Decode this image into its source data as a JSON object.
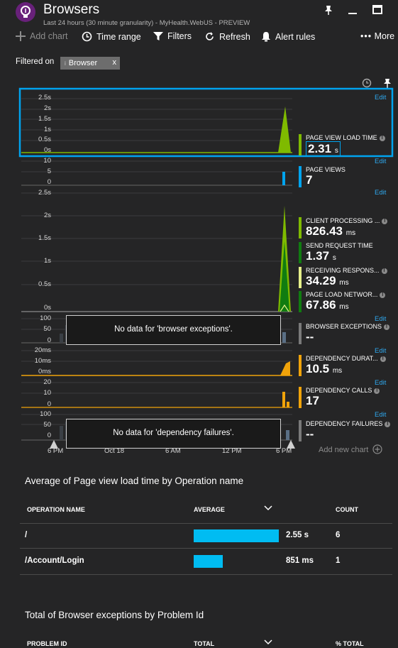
{
  "header": {
    "title": "Browsers",
    "subtitle": "Last 24 hours (30 minute granularity) - MyHealth.WebUS - PREVIEW"
  },
  "toolbar": {
    "add_chart": "Add chart",
    "time_range": "Time range",
    "filters": "Filters",
    "refresh": "Refresh",
    "alert_rules": "Alert rules",
    "more": "More"
  },
  "filter": {
    "label": "Filtered on",
    "chip": "Browser"
  },
  "colors": {
    "accent": "#00a4ef",
    "green": "#7fba00",
    "darkgreen": "#107c10",
    "yellow": "#fcd116",
    "orange": "#f0a30a",
    "blue": "#00bcf2"
  },
  "charts": {
    "edit_label": "Edit",
    "page_view_load": {
      "ylabels": [
        "2.5s",
        "2s",
        "1.5s",
        "1s",
        "0.5s",
        "0s"
      ],
      "kpi_name": "PAGE VIEW LOAD TIME",
      "kpi_value": "2.31",
      "kpi_unit": "s"
    },
    "page_views": {
      "ylabels": [
        "10",
        "5",
        "0"
      ],
      "kpi_name": "PAGE VIEWS",
      "kpi_value": "7",
      "kpi_unit": ""
    },
    "breakdown": {
      "ylabels": [
        "2.5s",
        "2s",
        "1.5s",
        "1s",
        "0.5s",
        "0s"
      ],
      "kpis": [
        {
          "name": "CLIENT PROCESSING ...",
          "value": "826.43",
          "unit": "ms"
        },
        {
          "name": "SEND REQUEST TIME",
          "value": "1.37",
          "unit": "s"
        },
        {
          "name": "RECEIVING RESPONS...",
          "value": "34.29",
          "unit": "ms"
        },
        {
          "name": "PAGE LOAD NETWOR...",
          "value": "67.86",
          "unit": "ms"
        }
      ]
    },
    "browser_exceptions": {
      "ylabels": [
        "100",
        "50",
        "0"
      ],
      "nodata": "No data for 'browser exceptions'.",
      "kpi_name": "BROWSER EXCEPTIONS",
      "kpi_value": "--"
    },
    "dependency_duration": {
      "ylabels": [
        "20ms",
        "10ms",
        "0ms"
      ],
      "kpi_name": "DEPENDENCY DURAT...",
      "kpi_value": "10.5",
      "kpi_unit": "ms"
    },
    "dependency_calls": {
      "ylabels": [
        "20",
        "10",
        "0"
      ],
      "kpi_name": "DEPENDENCY CALLS",
      "kpi_value": "17"
    },
    "dependency_failures": {
      "ylabels": [
        "100",
        "50",
        "0"
      ],
      "nodata": "No data for 'dependency failures'.",
      "kpi_name": "DEPENDENCY FAILURES",
      "kpi_value": "--"
    },
    "xaxis": [
      "6 PM",
      "Oct 18",
      "6 AM",
      "12 PM",
      "6 PM"
    ],
    "add_new_chart": "Add new chart"
  },
  "table1": {
    "title": "Average of Page view load time by Operation name",
    "headers": [
      "OPERATION NAME",
      "AVERAGE",
      "COUNT"
    ],
    "rows": [
      {
        "name": "/",
        "average": "2.55 s",
        "count": "6",
        "fill": 1.0
      },
      {
        "name": "/Account/Login",
        "average": "851 ms",
        "count": "1",
        "fill": 0.34
      }
    ]
  },
  "table2": {
    "title": "Total of Browser exceptions by Problem Id",
    "headers": [
      "PROBLEM ID",
      "TOTAL",
      "% TOTAL"
    ]
  }
}
